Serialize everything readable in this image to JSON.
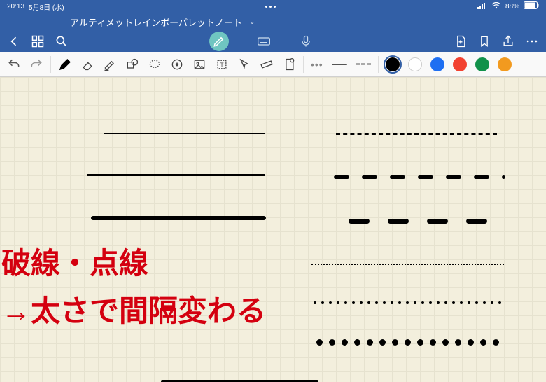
{
  "status": {
    "time": "20:13",
    "date": "5月8日 (水)",
    "battery": "88%"
  },
  "title": {
    "text": "アルティメットレインボーパレットノート"
  },
  "toolbar": {
    "colors": {
      "black": "#000000",
      "white": "#ffffff",
      "blue": "#1e6ff2",
      "red": "#f24130",
      "green": "#11914a",
      "orange": "#f29a1f"
    }
  },
  "annotations": {
    "line1": "破線・点線",
    "line2": "→太さで間隔変わる"
  }
}
